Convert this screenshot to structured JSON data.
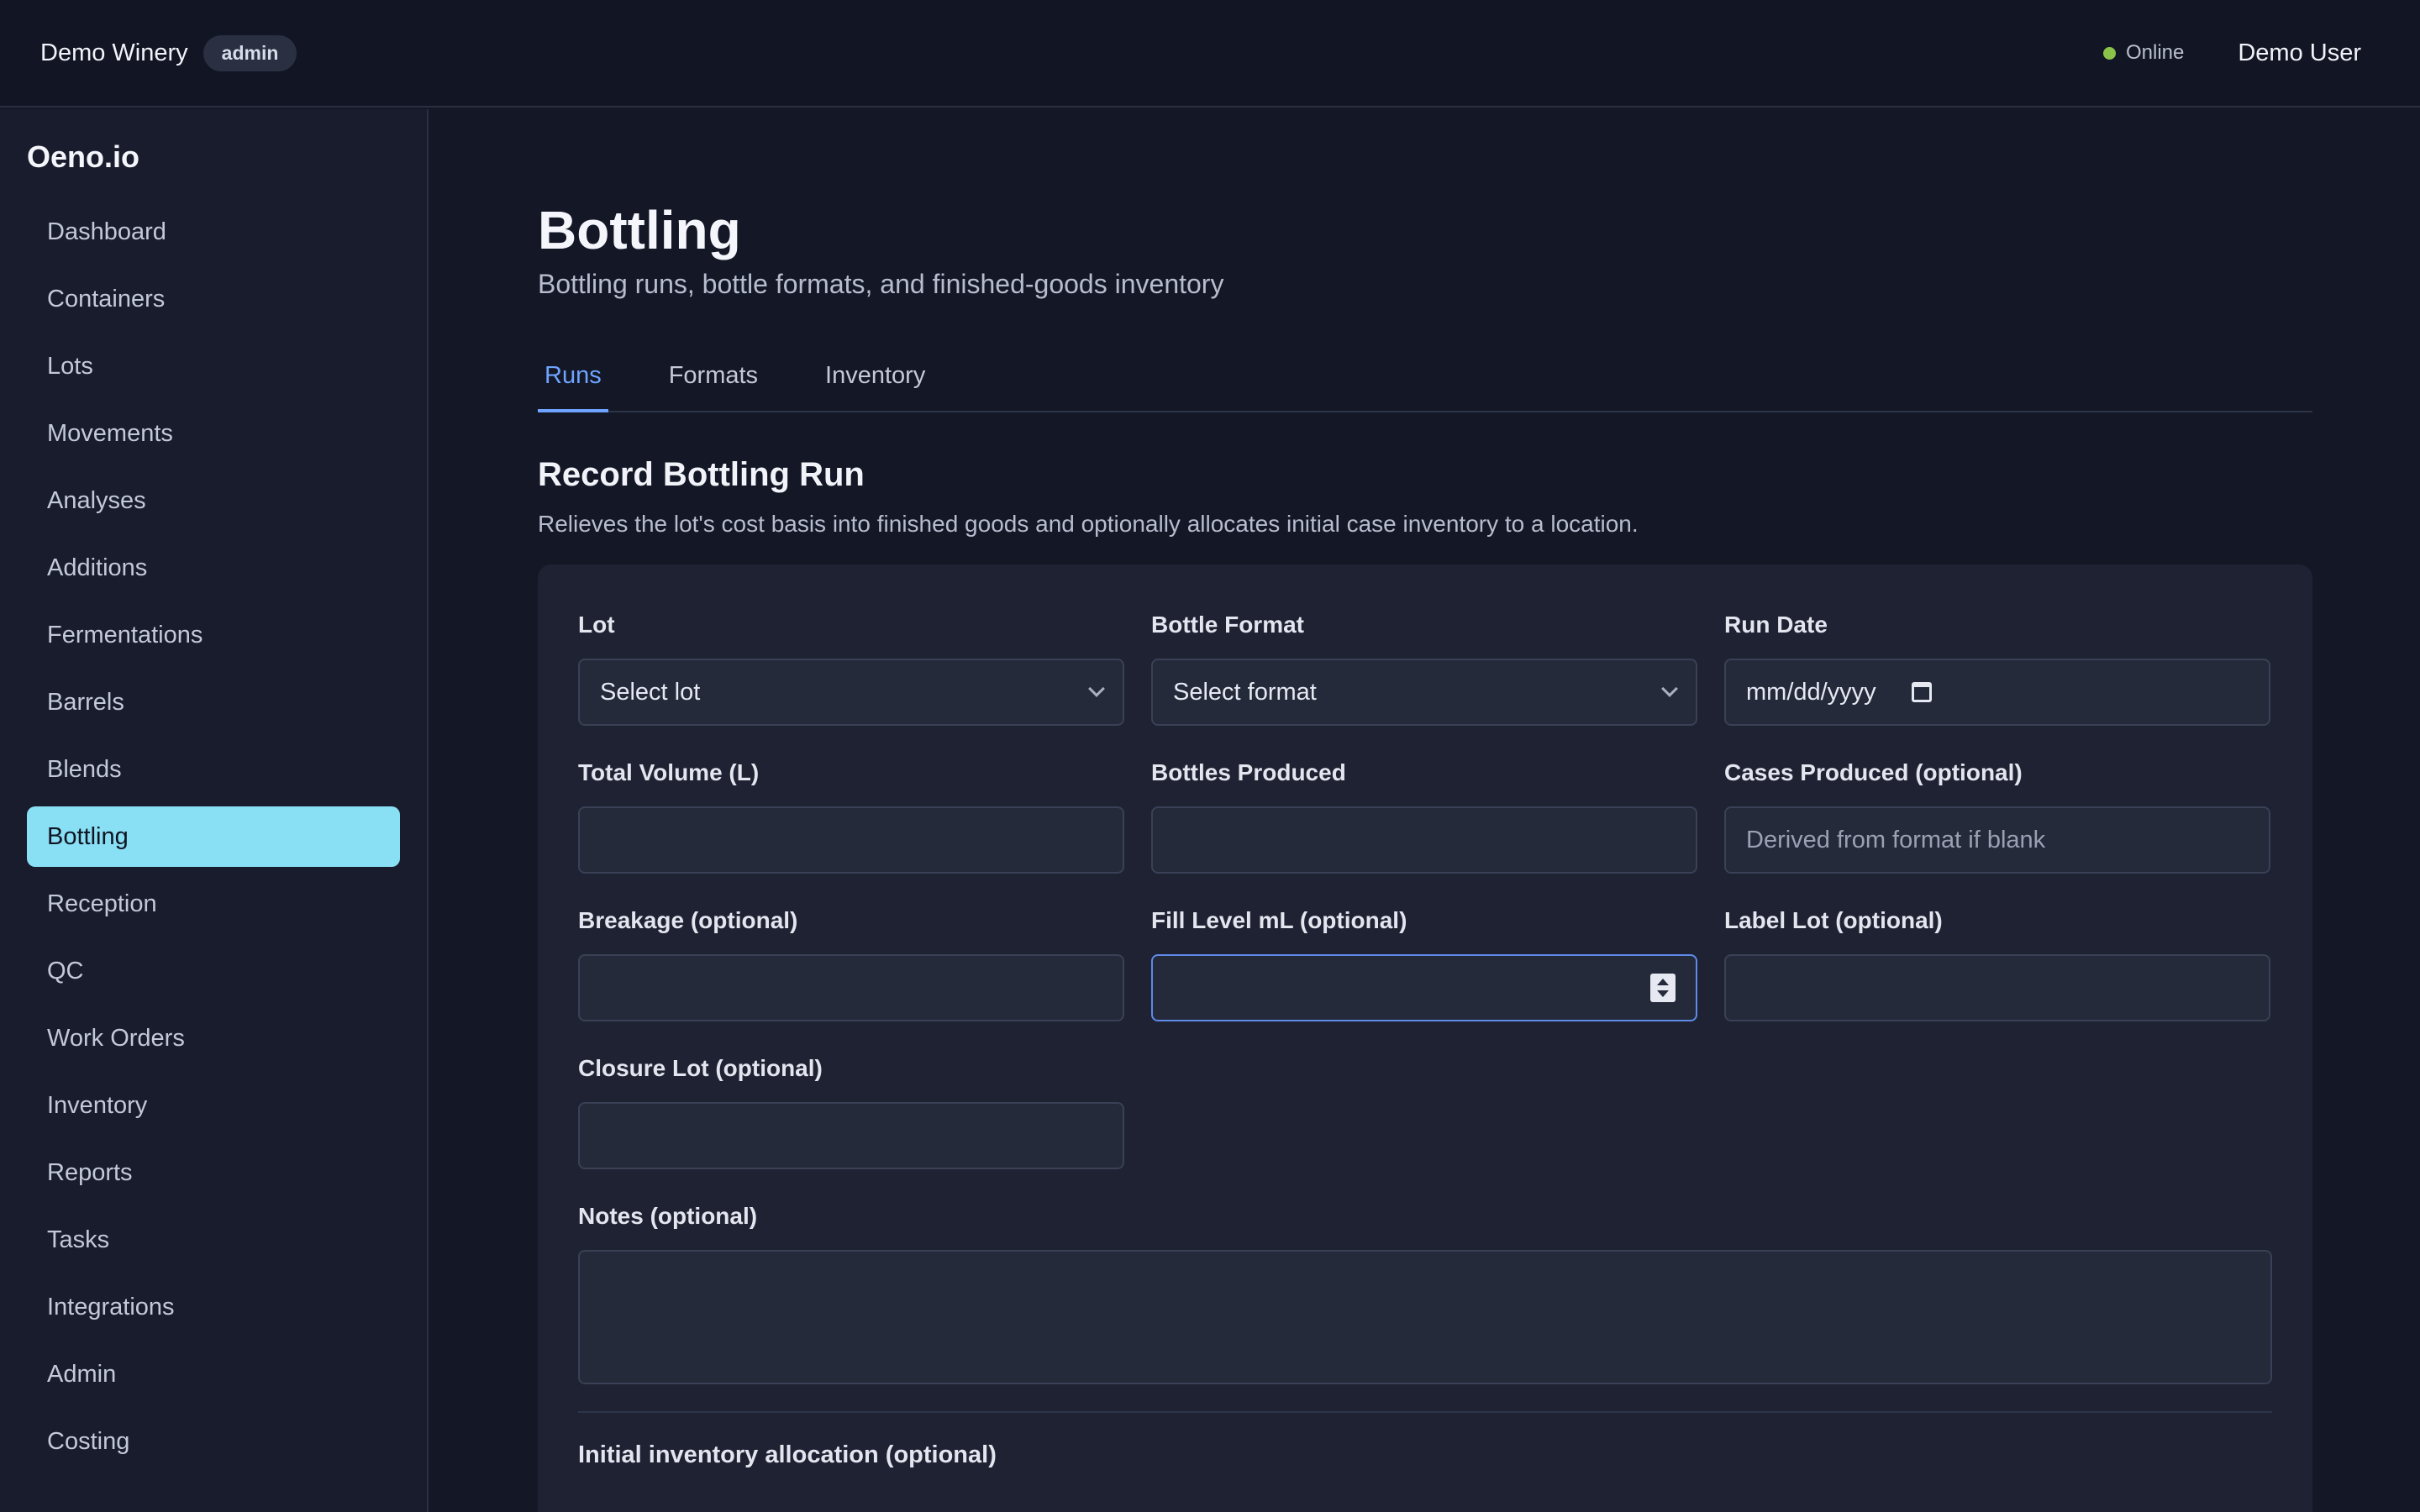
{
  "topbar": {
    "org_name": "Demo Winery",
    "role": "admin",
    "status": "Online",
    "user": "Demo User"
  },
  "sidebar": {
    "brand": "Oeno.io",
    "items": [
      {
        "label": "Dashboard"
      },
      {
        "label": "Containers"
      },
      {
        "label": "Lots"
      },
      {
        "label": "Movements"
      },
      {
        "label": "Analyses"
      },
      {
        "label": "Additions"
      },
      {
        "label": "Fermentations"
      },
      {
        "label": "Barrels"
      },
      {
        "label": "Blends"
      },
      {
        "label": "Bottling",
        "active": true
      },
      {
        "label": "Reception"
      },
      {
        "label": "QC"
      },
      {
        "label": "Work Orders"
      },
      {
        "label": "Inventory"
      },
      {
        "label": "Reports"
      },
      {
        "label": "Tasks"
      },
      {
        "label": "Integrations"
      },
      {
        "label": "Admin"
      },
      {
        "label": "Costing"
      }
    ]
  },
  "page": {
    "title": "Bottling",
    "subtitle": "Bottling runs, bottle formats, and finished-goods inventory",
    "tabs": [
      "Runs",
      "Formats",
      "Inventory"
    ],
    "active_tab": "Runs"
  },
  "form": {
    "title": "Record Bottling Run",
    "description": "Relieves the lot's cost basis into finished goods and optionally allocates initial case inventory to a location.",
    "lot": {
      "label": "Lot",
      "value": "Select lot"
    },
    "bottle_format": {
      "label": "Bottle Format",
      "value": "Select format"
    },
    "run_date": {
      "label": "Run Date",
      "value": "mm/dd/yyyy"
    },
    "total_volume": {
      "label": "Total Volume (L)",
      "value": ""
    },
    "bottles_produced": {
      "label": "Bottles Produced",
      "value": ""
    },
    "cases_produced": {
      "label": "Cases Produced (optional)",
      "placeholder": "Derived from format if blank"
    },
    "breakage": {
      "label": "Breakage (optional)",
      "value": ""
    },
    "fill_level": {
      "label": "Fill Level mL (optional)",
      "value": ""
    },
    "label_lot": {
      "label": "Label Lot (optional)",
      "value": ""
    },
    "closure_lot": {
      "label": "Closure Lot (optional)",
      "value": ""
    },
    "notes": {
      "label": "Notes (optional)",
      "value": ""
    },
    "allocation_title": "Initial inventory allocation (optional)"
  }
}
